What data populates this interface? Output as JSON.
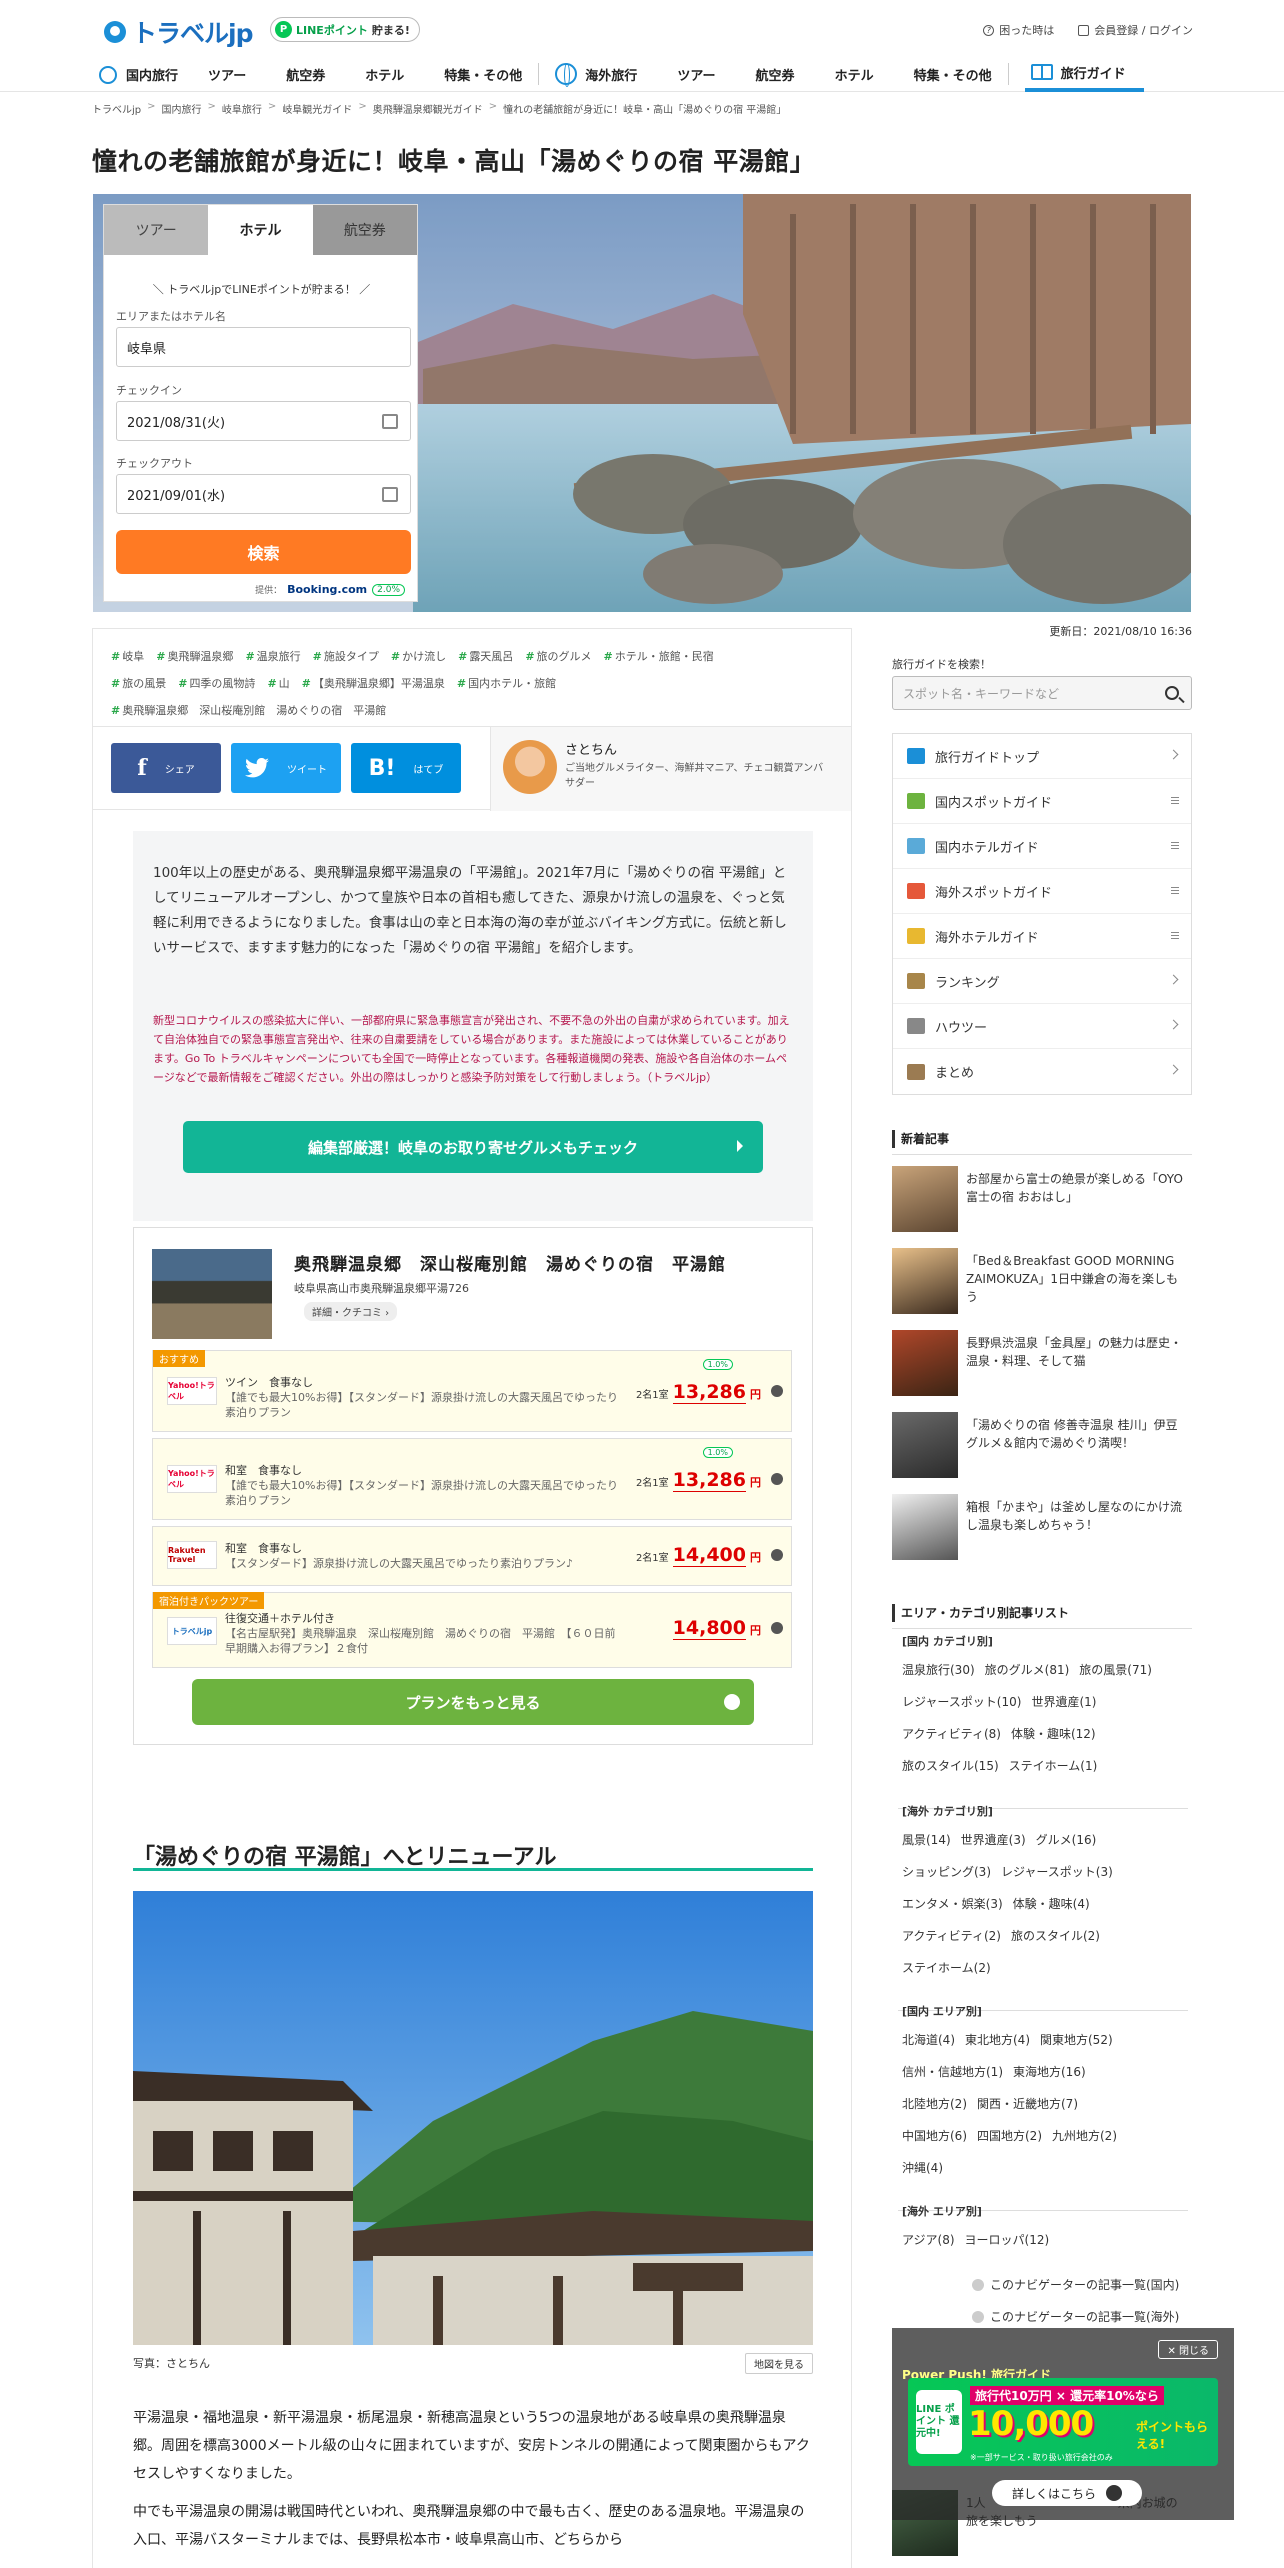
{
  "header": {
    "logo": "トラベルjp",
    "line_badge": {
      "prefix": "LINEポイント",
      "suffix": "貯まる!"
    },
    "links": [
      "困った時は",
      "会員登録 / ログイン"
    ],
    "nav": [
      {
        "label": "国内旅行",
        "icon": "japan-map-icon"
      },
      {
        "label": "ツアー"
      },
      {
        "label": "航空券"
      },
      {
        "label": "ホテル"
      },
      {
        "label": "特集・その他"
      },
      {
        "label": "海外旅行",
        "icon": "globe-icon"
      },
      {
        "label": "ツアー"
      },
      {
        "label": "航空券"
      },
      {
        "label": "ホテル"
      },
      {
        "label": "特集・その他"
      },
      {
        "label": "旅行ガイド",
        "icon": "book-icon"
      }
    ]
  },
  "breadcrumb": [
    "トラベルjp",
    "国内旅行",
    "岐阜旅行",
    "岐阜観光ガイド",
    "奥飛騨温泉郷観光ガイド",
    "憧れの老舗旅館が身近に！岐阜・高山「湯めぐりの宿 平湯館」"
  ],
  "title": "憧れの老舗旅館が身近に！岐阜・高山「湯めぐりの宿 平湯館」",
  "search": {
    "tabs": [
      "ツアー",
      "ホテル",
      "航空券"
    ],
    "active_tab": "ホテル",
    "promo": "＼ トラベルjpでLINEポイントが貯まる！ ／",
    "area_label": "エリアまたはホテル名",
    "area_value": "岐阜県",
    "checkin_label": "チェックイン",
    "checkin_value": "2021/08/31(火)",
    "checkout_label": "チェックアウト",
    "checkout_value": "2021/09/01(水)",
    "button": "検索",
    "provider_prefix": "提供：",
    "provider": "Booking.com",
    "points": "2.0%"
  },
  "updated": "更新日：2021/08/10 16:36",
  "tags": [
    "岐阜",
    "奥飛騨温泉郷",
    "温泉旅行",
    "施設タイプ",
    "かけ流し",
    "露天風呂",
    "旅のグルメ",
    "ホテル・旅館・民宿",
    "旅の風景",
    "四季の風物詩",
    "山",
    "【奥飛騨温泉郷】平湯温泉",
    "国内ホテル・旅館",
    "奥飛騨温泉郷　深山桜庵別館　湯めぐりの宿　平湯館"
  ],
  "share": {
    "facebook": "シェア",
    "twitter": "ツイート",
    "hatena": "はてブ",
    "hatena_mark": "B!"
  },
  "author": {
    "name": "さとちん",
    "desc": "ご当地グルメライター、海鮮丼マニア、チェコ観賞アンバサダー"
  },
  "intro": "100年以上の歴史がある、奥飛騨温泉郷平湯温泉の「平湯館」。2021年7月に「湯めぐりの宿 平湯館」としてリニューアルオープンし、かつて皇族や日本の首相も癒してきた、源泉かけ流しの温泉を、ぐっと気軽に利用できるようになりました。食事は山の幸と日本海の海の幸が並ぶバイキング方式に。伝統と新しいサービスで、ますます魅力的になった「湯めぐりの宿 平湯館」を紹介します。",
  "covid_notice": "新型コロナウイルスの感染拡大に伴い、一部都府県に緊急事態宣言が発出され、不要不急の外出の自粛が求められています。加えて自治体独自での緊急事態宣言発出や、往来の自粛要請をしている場合があります。また施設によっては休業していることがあります。Go To トラベルキャンペーンについても全国で一時停止となっています。各種報道機関の発表、施設や各自治体のホームページなどで最新情報をご確認ください。外出の際はしっかりと感染予防対策をして行動しましょう。（トラベルjp）",
  "gourmet_button": "編集部厳選！岐阜のお取り寄せグルメもチェック",
  "hotel": {
    "name": "奥飛騨温泉郷　深山桜庵別館　湯めぐりの宿　平湯館",
    "address": "岐阜県高山市奥飛騨温泉郷平湯726",
    "detail": "詳細・クチコミ ›",
    "plans": [
      {
        "badge": "おすすめ",
        "provider": "Yahoo!トラベル",
        "room": "ツイン　食事なし",
        "desc": "【誰でも最大10%お得】【スタンダード】源泉掛け流しの大露天風呂でゆったり素泊りプラン",
        "per": "2名1室",
        "price": "13,286",
        "unit": "円",
        "points": "1.0%"
      },
      {
        "provider": "Yahoo!トラベル",
        "room": "和室　食事なし",
        "desc": "【誰でも最大10%お得】【スタンダード】源泉掛け流しの大露天風呂でゆったり素泊りプラン",
        "per": "2名1室",
        "price": "13,286",
        "unit": "円",
        "points": "1.0%"
      },
      {
        "provider": "Rakuten Travel",
        "room": "和室　食事なし",
        "desc": "【スタンダード】源泉掛け流しの大露天風呂でゆったり素泊りプラン♪",
        "per": "2名1室",
        "price": "14,400",
        "unit": "円"
      },
      {
        "badge": "宿泊付きパックツアー",
        "provider": "トラベルjp",
        "room": "往復交通＋ホテル付き",
        "desc": "【名古屋駅発】奥飛騨温泉　深山桜庵別館　湯めぐりの宿　平湯館　【６０日前早期購入お得プラン】２食付",
        "price": "14,800",
        "unit": "円"
      }
    ],
    "more_button": "プランをもっと見る"
  },
  "section1": {
    "heading": "「湯めぐりの宿 平湯館」へとリニューアル",
    "caption": "写真：さとちん",
    "map_button": "地図を見る"
  },
  "body": [
    "平湯温泉・福地温泉・新平湯温泉・栃尾温泉・新穂高温泉という5つの温泉地がある岐阜県の奥飛騨温泉郷。周囲を標高3000メートル級の山々に囲まれていますが、安房トンネルの開通によって関東圏からもアクセスしやすくなりました。",
    "中でも平湯温泉の開湯は戦国時代といわれ、奥飛騨温泉郷の中で最も古く、歴史のある温泉地。平湯温泉の入口、平湯バスターミナルまでは、長野県松本市・岐阜県高山市、どちらから"
  ],
  "sidebar": {
    "search_label": "旅行ガイドを検索！",
    "search_placeholder": "スポット名・キーワードなど",
    "menu": [
      {
        "label": "旅行ガイドトップ",
        "icon": "book-icon",
        "color": "#1b8fd7"
      },
      {
        "label": "国内スポットガイド",
        "icon": "chart-icon",
        "color": "#6db33f"
      },
      {
        "label": "国内ホテルガイド",
        "icon": "building-icon",
        "color": "#5aaad8"
      },
      {
        "label": "海外スポットガイド",
        "icon": "airplane-icon",
        "color": "#e5583a"
      },
      {
        "label": "海外ホテルガイド",
        "icon": "bed-icon",
        "color": "#e8b830"
      },
      {
        "label": "ランキング",
        "icon": "crown-icon",
        "color": "#a8864a"
      },
      {
        "label": "ハウツー",
        "icon": "pencil-icon",
        "color": "#888888"
      },
      {
        "label": "まとめ",
        "icon": "stack-icon",
        "color": "#9b7b52"
      }
    ],
    "news_heading": "新着記事",
    "news": [
      "お部屋から富士の絶景が楽しめる「OYO 富士の宿 おおはし」",
      "「Bed＆Breakfast GOOD MORNING ZAIMOKUZA」1日中鎌倉の海を楽しもう",
      "長野県渋温泉「金具屋」の魅力は歴史・温泉・料理、そして猫",
      "「湯めぐりの宿 修善寺温泉 桂川」伊豆グルメ＆館内で湯めぐり満喫！",
      "箱根「かまや」は釜めし屋なのにかけ流し温泉も楽しめちゃう！"
    ],
    "cat_heading": "エリア・カテゴリ別記事リスト",
    "groups": [
      {
        "h": "[国内 カテゴリ別]",
        "items": [
          "温泉旅行(30)",
          "旅のグルメ(81)",
          "旅の風景(71)",
          "レジャースポット(10)",
          "世界遺産(1)",
          "アクティビティ(8)",
          "体験・趣味(12)",
          "旅のスタイル(15)",
          "ステイホーム(1)"
        ]
      },
      {
        "h": "[海外 カテゴリ別]",
        "items": [
          "風景(14)",
          "世界遺産(3)",
          "グルメ(16)",
          "ショッピング(3)",
          "レジャースポット(3)",
          "エンタメ・娯楽(3)",
          "体験・趣味(4)",
          "アクティビティ(2)",
          "旅のスタイル(2)",
          "ステイホーム(2)"
        ]
      },
      {
        "h": "[国内 エリア別]",
        "items": [
          "北海道(4)",
          "東北地方(4)",
          "関東地方(52)",
          "信州・信越地方(1)",
          "東海地方(16)",
          "北陸地方(2)",
          "関西・近畿地方(7)",
          "中国地方(6)",
          "四国地方(2)",
          "九州地方(2)",
          "沖縄(4)"
        ]
      },
      {
        "h": "[海外 エリア別]",
        "items": [
          "アジア(8)",
          "ヨーロッパ(12)"
        ]
      }
    ],
    "nav_links": [
      "このナビゲーターの記事一覧(国内)",
      "このナビゲーターの記事一覧(海外)"
    ]
  },
  "popup": {
    "close": "閉じる",
    "heading": "Power Push! 旅行ガイド",
    "line_label": "LINE ポイント 還元中!",
    "banner_top": "旅行代10万円 × 還元率10%なら",
    "banner_big": "10,000",
    "banner_tail": "ポイントもらえる!",
    "banner_note": "※一部サービス・取り扱い旅行会社のみ",
    "more": "詳しくはこちら",
    "under_text": "1人　　　　　　　　　　　県内お城の旅を楽しもう"
  },
  "colors": {
    "brand": "#1b8fd7",
    "accent": "#ff7a23",
    "teal": "#12b596",
    "green": "#6db33f",
    "price": "#dd0000"
  }
}
